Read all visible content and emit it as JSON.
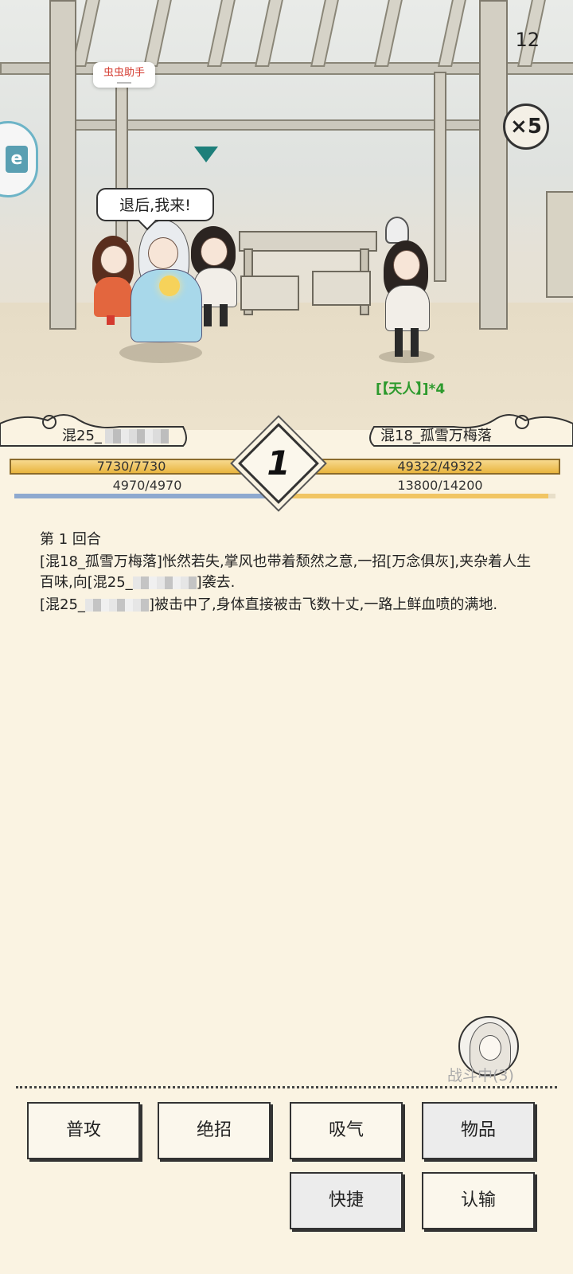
{
  "status": {
    "time": "12"
  },
  "controls": {
    "speed": "×5",
    "assistant_label": "虫虫助手"
  },
  "scene": {
    "speech_bubble": "退后,我来!",
    "enemy_title": "[【天人】]*4"
  },
  "players": {
    "left_name": "混25_",
    "right_name": "混18_孤雪万梅落"
  },
  "stats": {
    "left_hp": "7730/7730",
    "left_mp": "4970/4970",
    "right_hp": "49322/49322",
    "right_mp": "13800/14200",
    "left_hp_fraction": 1.0,
    "left_mp_fraction": 1.0,
    "right_hp_fraction": 1.0,
    "right_mp_fraction": 0.9718
  },
  "round": {
    "number": "1"
  },
  "log": {
    "heading": "第 1 回合",
    "line1_part1": "[混18_孤雪万梅落]怅然若失,掌风也带着颓然之意,一招[万念俱灰],夹杂着人生百味,向[混25_",
    "line1_part2": "]袭去.",
    "line2_part1": "[混25_",
    "line2_part2": "]被击中了,身体直接被击飞数十丈,一路上鲜血喷的满地."
  },
  "battle_status": "战斗中(3)",
  "actions": {
    "attack": "普攻",
    "ultimate": "绝招",
    "breathe": "吸气",
    "items": "物品",
    "quick": "快捷",
    "surrender": "认输"
  },
  "colors": {
    "hp": "#f3c25c",
    "mp_left": "#8ea9cf",
    "title_green": "#2d9a2d",
    "assistant_red": "#d43a2f"
  }
}
